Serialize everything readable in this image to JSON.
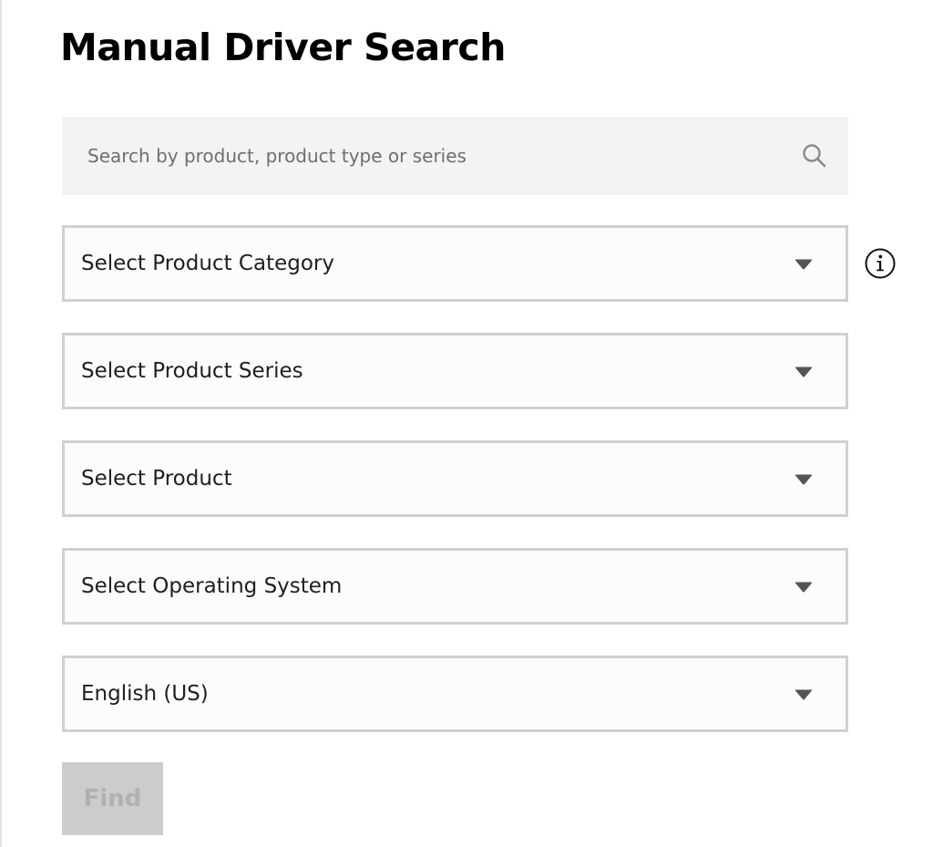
{
  "header": {
    "title": "Manual Driver Search"
  },
  "search": {
    "placeholder": "Search by product, product type or series",
    "value": "",
    "icon": "search-icon"
  },
  "selects": {
    "product_category": {
      "label": "Select Product Category",
      "icon": "chevron-down-icon"
    },
    "product_series": {
      "label": "Select Product Series",
      "icon": "chevron-down-icon"
    },
    "product": {
      "label": "Select Product",
      "icon": "chevron-down-icon"
    },
    "operating_system": {
      "label": "Select Operating System",
      "icon": "chevron-down-icon"
    },
    "language": {
      "label": "English (US)",
      "icon": "chevron-down-icon"
    }
  },
  "info": {
    "icon": "info-icon"
  },
  "actions": {
    "find_label": "Find",
    "find_enabled": false
  },
  "colors": {
    "title": "#000000",
    "search_bg": "#f3f3f3",
    "select_border": "#d0d0d0",
    "caret": "#555555",
    "button_disabled_bg": "#cccccc",
    "button_disabled_text": "#b0b0b0"
  }
}
